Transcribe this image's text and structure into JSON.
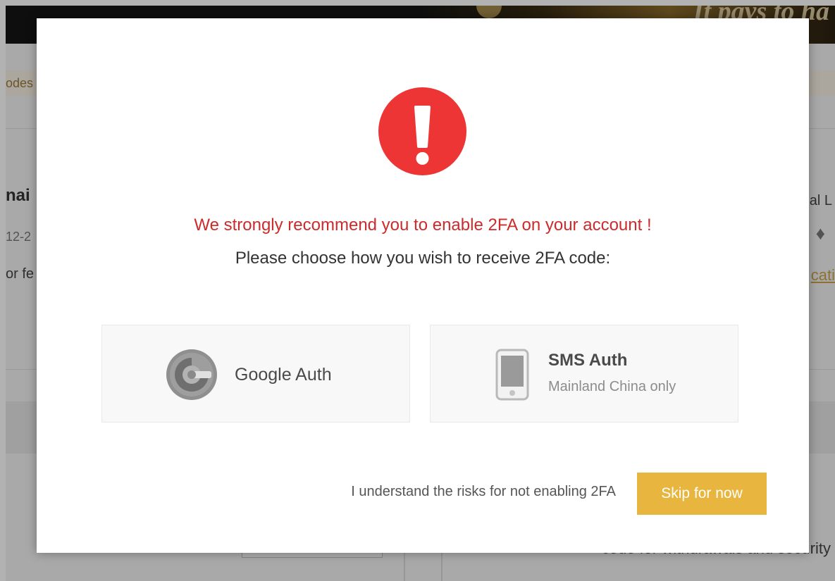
{
  "background": {
    "banner_text": "It pays to ha",
    "nav_fragment": "odes",
    "title_fragment": "nai",
    "date_fragment": "12-2",
    "fee_fragment": "or fe",
    "right_label_fragment": "al L",
    "right_link_fragment": "cati",
    "bottom_text_fragment": "code for withdrawals and security"
  },
  "dialog": {
    "headline": "We strongly recommend you to enable 2FA on your account !",
    "subline": "Please choose how you wish to receive 2FA code:",
    "options": [
      {
        "label": "Google Auth",
        "icon": "google-authenticator-icon"
      },
      {
        "label": "SMS Auth",
        "sublabel": "Mainland China only",
        "icon": "phone-icon"
      }
    ],
    "risk_text": "I understand the risks for not enabling 2FA",
    "skip_label": "Skip for now"
  },
  "colors": {
    "alert_red": "#ee3535",
    "headline_red": "#cc2b2b",
    "skip_button": "#e8b53e",
    "banner_gold": "#d9c9a0",
    "overlay": "rgba(0,0,0,0.30)"
  }
}
